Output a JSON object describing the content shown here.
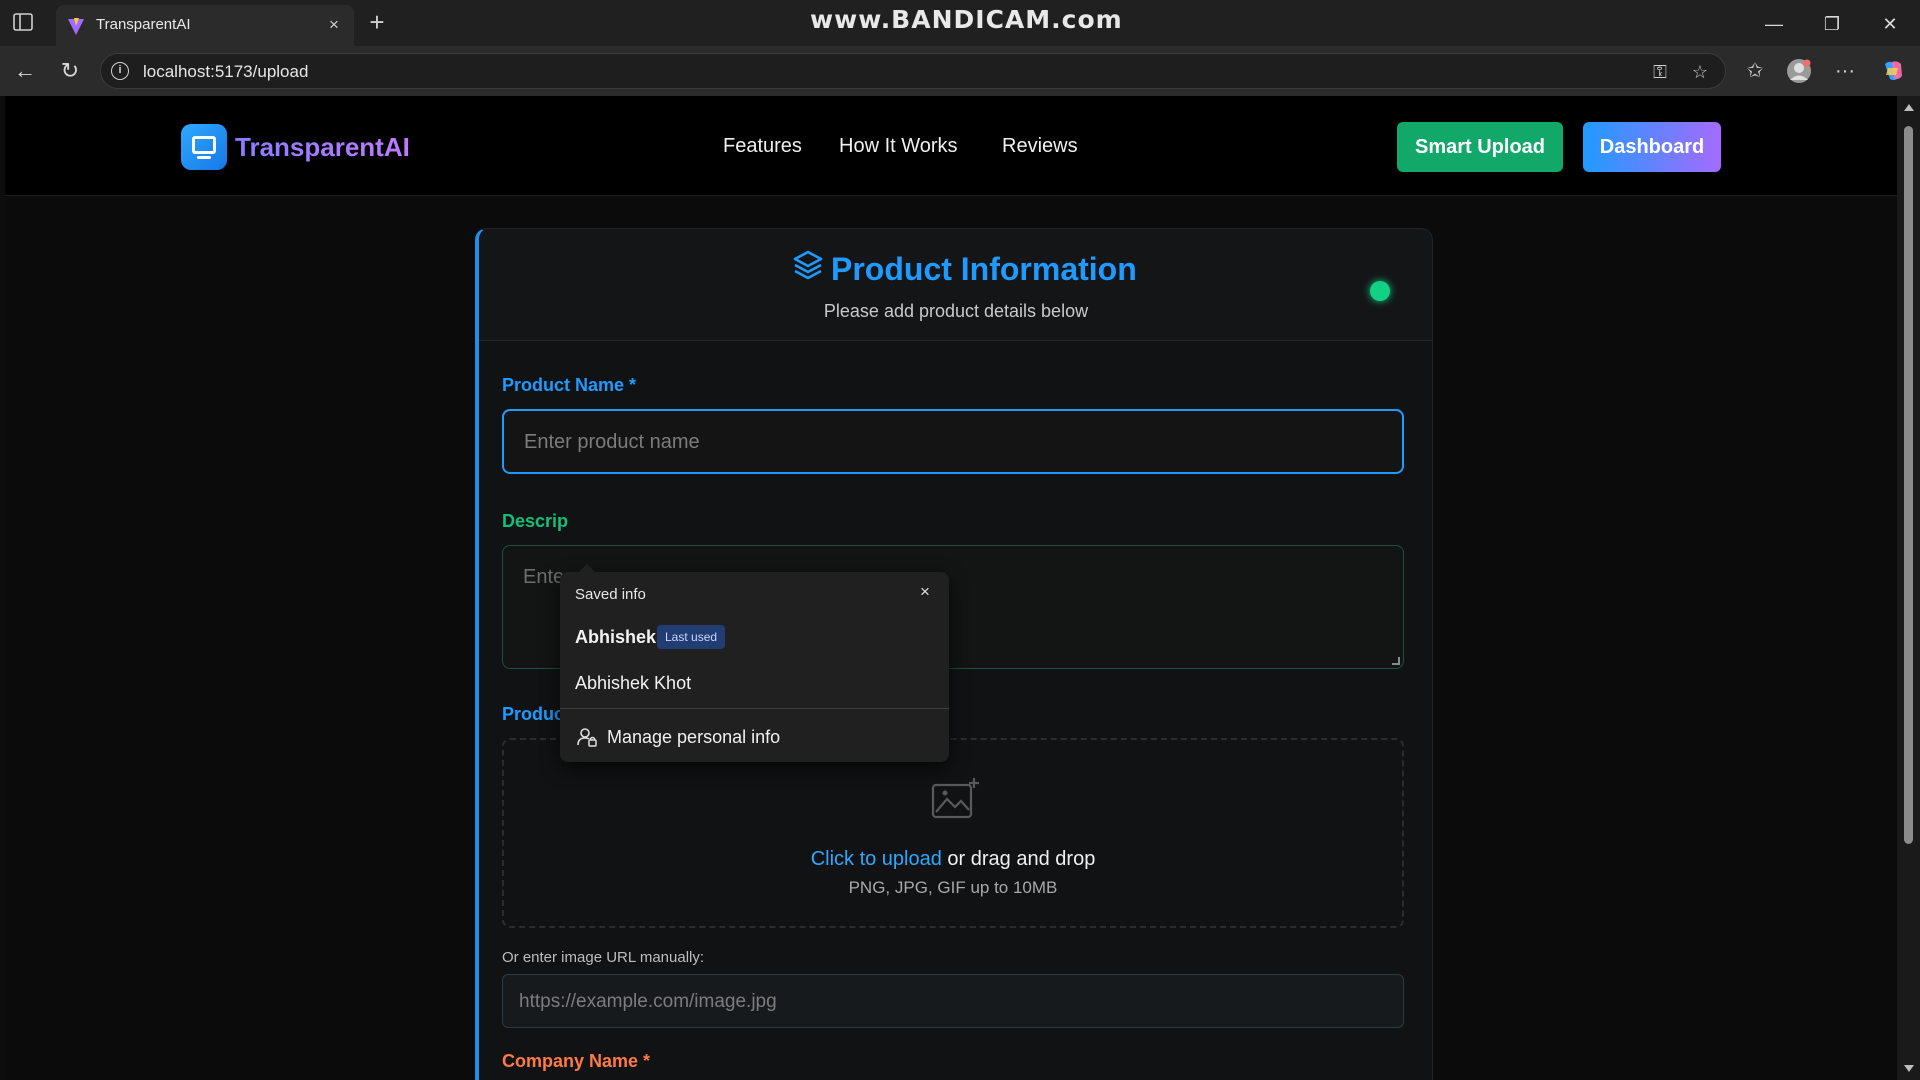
{
  "browser": {
    "tab_title": "TransparentAI",
    "tab_close": "×",
    "new_tab": "+",
    "url": "localhost:5173/upload",
    "watermark": "www.BANDICAM.com"
  },
  "navbar": {
    "brand": "TransparentAI",
    "links": [
      "Features",
      "How It Works",
      "Reviews"
    ],
    "smart_upload": "Smart Upload",
    "dashboard": "Dashboard"
  },
  "card": {
    "title": "Product Information",
    "subtitle": "Please add product details below",
    "status_color": "#12d185"
  },
  "form": {
    "product_name_label": "Product Name *",
    "product_name_placeholder": "Enter product name",
    "description_label": "Descrip",
    "description_placeholder": "Ente",
    "product_image_label": "Product Image",
    "upload_link": "Click to upload",
    "upload_rest": " or drag and drop",
    "upload_hint": "PNG, JPG, GIF up to 10MB",
    "url_label": "Or enter image URL manually:",
    "url_placeholder": "https://example.com/image.jpg",
    "company_name_label": "Company Name *"
  },
  "autofill": {
    "title": "Saved info",
    "close": "×",
    "items": [
      "Abhishek",
      "Abhishek Khot"
    ],
    "badge": "Last used",
    "manage": "Manage personal info"
  },
  "colors": {
    "accent_blue": "#1f9bff",
    "accent_green": "#12a86a",
    "label_green": "#12c07a",
    "label_orange": "#ff7a45"
  }
}
